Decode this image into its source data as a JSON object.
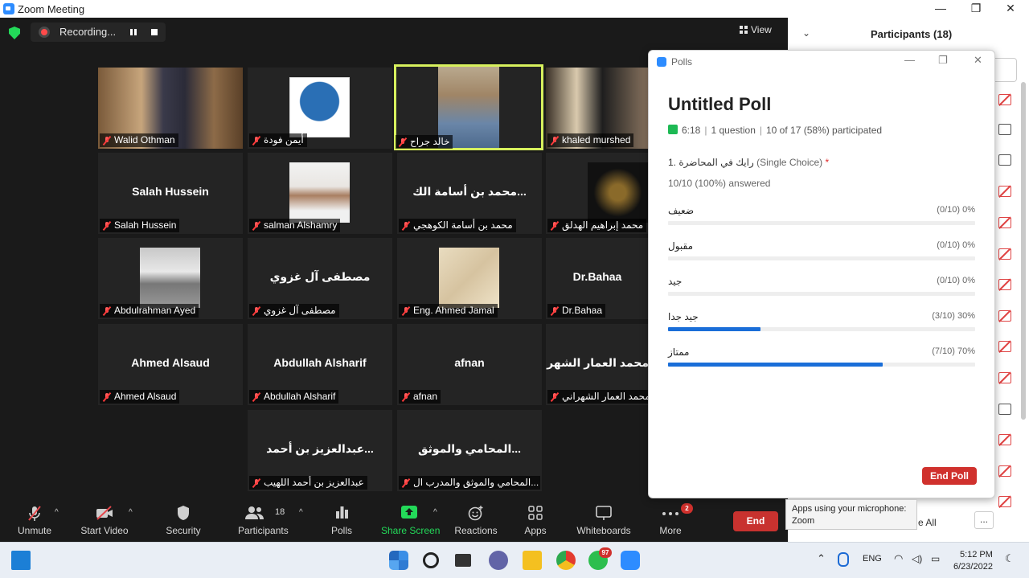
{
  "window": {
    "title": "Zoom Meeting",
    "minimize": "—",
    "maximize": "❐",
    "close": "✕"
  },
  "recording": {
    "label": "Recording..."
  },
  "view": {
    "label": "View"
  },
  "tiles": [
    {
      "name": "Walid Othman",
      "big": "",
      "photo": "person"
    },
    {
      "name": "أيمن فودة",
      "big": "",
      "photo": "logo"
    },
    {
      "name": "خالد جراح",
      "big": "",
      "photo": "person",
      "active": true
    },
    {
      "name": "khaled murshed",
      "big": "",
      "photo": "person"
    },
    {
      "name": "Salah Hussein",
      "big": "Salah Hussein"
    },
    {
      "name": "salman Alshamry",
      "big": "",
      "photo": "person"
    },
    {
      "name": "محمد بن أسامة الكوهجي",
      "big": "محمد بن أسامة الك..."
    },
    {
      "name": "محمد إبراهيم الهدلق",
      "big": "",
      "photo": "calligraphy"
    },
    {
      "name": "Abdulrahman Ayed",
      "big": "",
      "photo": "sign"
    },
    {
      "name": "مصطفى آل غزوي",
      "big": "مصطفى آل غزوي"
    },
    {
      "name": "Eng. Ahmed Jamal",
      "big": "",
      "photo": "drawing"
    },
    {
      "name": "Dr.Bahaa",
      "big": "Dr.Bahaa"
    },
    {
      "name": "Ahmed Alsaud",
      "big": "Ahmed Alsaud"
    },
    {
      "name": "Abdullah Alsharif",
      "big": "Abdullah Alsharif"
    },
    {
      "name": "afnan",
      "big": "afnan"
    },
    {
      "name": "محمد العمار الشهراني",
      "big": "محمد العمار الشهر"
    },
    {
      "name": "عبدالعزيز بن أحمد اللهيب",
      "big": "عبدالعزيز بن أحمد..."
    },
    {
      "name": "المحامي والموثق والمدرب ال...",
      "big": "المحامي والموثق..."
    }
  ],
  "toolbar": {
    "unmute": "Unmute",
    "start_video": "Start Video",
    "security": "Security",
    "participants": "Participants",
    "participants_count": "18",
    "polls": "Polls",
    "share_screen": "Share Screen",
    "reactions": "Reactions",
    "apps": "Apps",
    "whiteboards": "Whiteboards",
    "more": "More",
    "more_badge": "2",
    "end": "End",
    "caret": "^"
  },
  "participants_panel": {
    "title": "Participants (18)",
    "chevron": "⌄",
    "see_all": "e All",
    "dots": "..."
  },
  "polls": {
    "window_title": "Polls",
    "poll_title": "Untitled Poll",
    "duration": "6:18",
    "questions": "1 question",
    "participation": "10 of 17 (58%) participated",
    "question_number": "1.",
    "question_text": "رايك في المحاضرة",
    "question_type": "(Single Choice)",
    "required_mark": "*",
    "answered": "10/10 (100%) answered",
    "options": [
      {
        "label": "ضعيف",
        "stat": "(0/10) 0%",
        "percent": 0
      },
      {
        "label": "مقبول",
        "stat": "(0/10) 0%",
        "percent": 0
      },
      {
        "label": "جيد",
        "stat": "(0/10) 0%",
        "percent": 0
      },
      {
        "label": "جيد جدا",
        "stat": "(3/10) 30%",
        "percent": 30
      },
      {
        "label": "ممتاز",
        "stat": "(7/10) 70%",
        "percent": 70
      }
    ],
    "end_poll": "End Poll"
  },
  "tooltip": {
    "line1": "Apps using your microphone:",
    "line2": "Zoom"
  },
  "taskbar": {
    "whatsapp_badge": "97",
    "lang": "ENG",
    "time": "5:12 PM",
    "date": "6/23/2022"
  }
}
